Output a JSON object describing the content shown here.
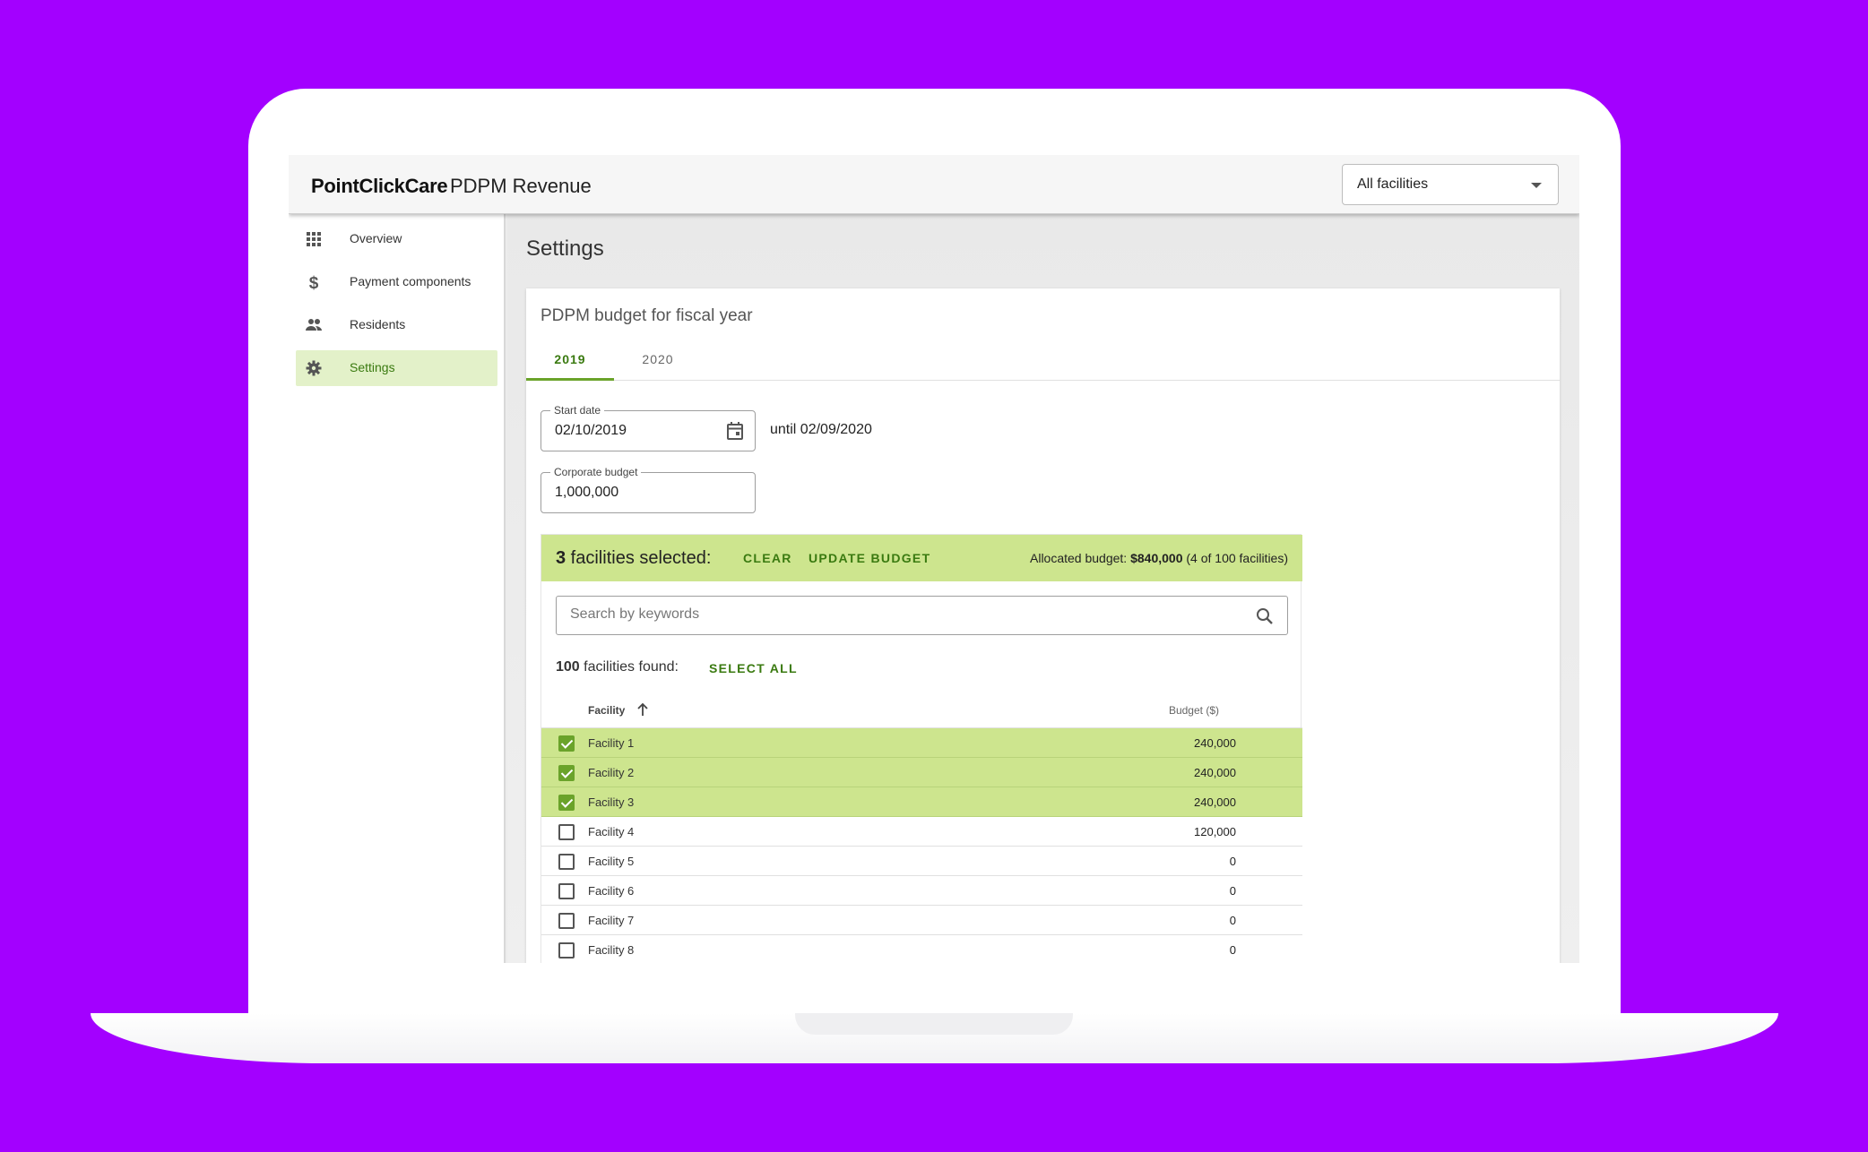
{
  "header": {
    "brand": "PointClickCare",
    "product": "PDPM Revenue",
    "facility_filter": "All facilities"
  },
  "sidebar": {
    "items": [
      {
        "label": "Overview",
        "icon": "grid-icon",
        "active": false
      },
      {
        "label": "Payment components",
        "icon": "dollar-icon",
        "active": false
      },
      {
        "label": "Residents",
        "icon": "people-icon",
        "active": false
      },
      {
        "label": "Settings",
        "icon": "gear-icon",
        "active": true
      }
    ]
  },
  "main": {
    "page_title": "Settings",
    "card_title": "PDPM budget for fiscal year",
    "tabs": [
      {
        "label": "2019",
        "active": true
      },
      {
        "label": "2020",
        "active": false
      }
    ],
    "start_date": {
      "label": "Start date",
      "value": "02/10/2019"
    },
    "until_text": "until 02/09/2020",
    "corporate_budget": {
      "label": "Corporate budget",
      "value": "1,000,000"
    }
  },
  "selection": {
    "count": "3",
    "count_suffix": " facilities selected:",
    "clear_label": "CLEAR",
    "update_label": "UPDATE BUDGET",
    "allocated_prefix": "Allocated budget: ",
    "allocated_amount": "$840,000",
    "allocated_suffix": " (4 of 100 facilities)"
  },
  "search": {
    "placeholder": "Search by keywords"
  },
  "results": {
    "count": "100",
    "count_suffix": " facilities found:",
    "select_all_label": "SELECT ALL"
  },
  "table": {
    "columns": [
      "Facility",
      "Budget ($)"
    ],
    "rows": [
      {
        "name": "Facility 1",
        "budget": "240,000",
        "selected": true
      },
      {
        "name": "Facility 2",
        "budget": "240,000",
        "selected": true
      },
      {
        "name": "Facility 3",
        "budget": "240,000",
        "selected": true
      },
      {
        "name": "Facility 4",
        "budget": "120,000",
        "selected": false
      },
      {
        "name": "Facility 5",
        "budget": "0",
        "selected": false
      },
      {
        "name": "Facility 6",
        "budget": "0",
        "selected": false
      },
      {
        "name": "Facility 7",
        "budget": "0",
        "selected": false
      },
      {
        "name": "Facility 8",
        "budget": "0",
        "selected": false
      }
    ]
  },
  "colors": {
    "background": "#a300ff",
    "accent_green": "#3a7a10",
    "selection_green": "#cde58e",
    "active_nav": "#e3f1c9"
  }
}
